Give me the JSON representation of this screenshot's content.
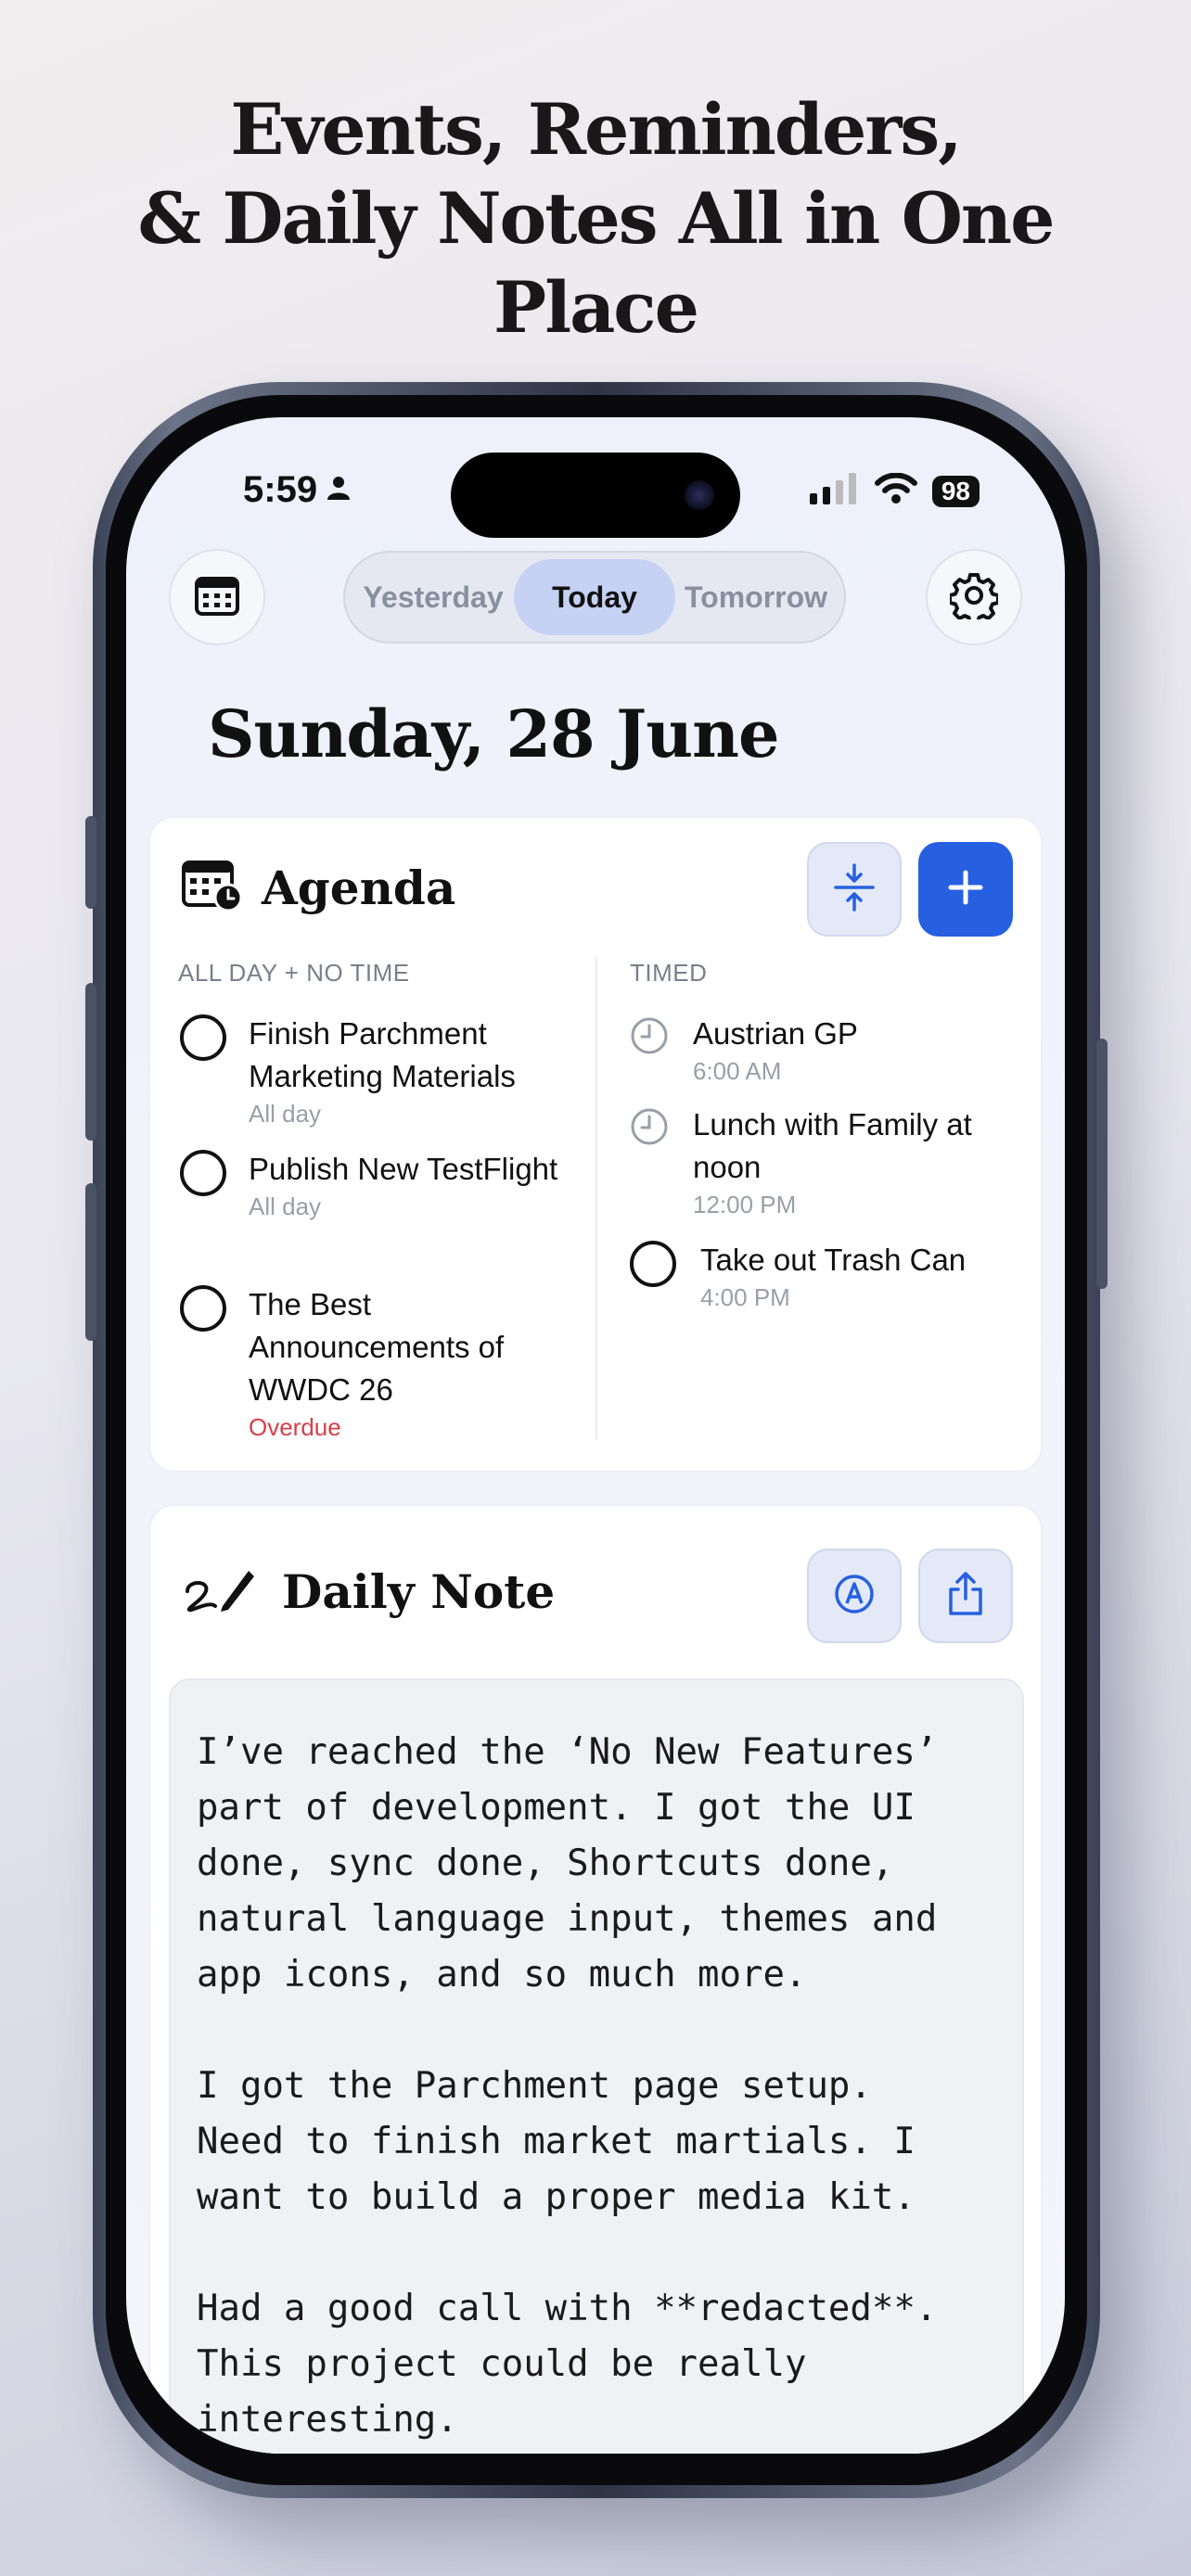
{
  "headline": {
    "line1": "Events, Reminders,",
    "line2": "& Daily Notes All in One",
    "line3": "Place"
  },
  "status_bar": {
    "time": "5:59",
    "battery": "98"
  },
  "toolbar": {
    "segments": [
      "Yesterday",
      "Today",
      "Tomorrow"
    ],
    "active_segment": "Today"
  },
  "date_title": "Sunday, 28 June",
  "agenda": {
    "title": "Agenda",
    "all_day_label": "ALL DAY + NO TIME",
    "timed_label": "TIMED",
    "all_day_items": [
      {
        "title": "Finish Parchment Marketing Materials",
        "sub": "All day"
      },
      {
        "title": "Publish New TestFlight",
        "sub": "All day"
      },
      {
        "title": "The Best Announcements of WWDC 26",
        "sub": "Overdue"
      }
    ],
    "timed_items": [
      {
        "title": "Austrian GP",
        "sub": "6:00 AM"
      },
      {
        "title": "Lunch with Family at noon",
        "sub": "12:00 PM"
      },
      {
        "title": "Take out Trash Can",
        "sub": "4:00 PM"
      }
    ]
  },
  "daily_note": {
    "title": "Daily Note",
    "text": "I’ve reached the ‘No New Features’\npart of development. I got the UI\ndone, sync done, Shortcuts done,\nnatural language input, themes and\napp icons, and so much more.\n\nI got the Parchment page setup.\nNeed to finish market martials. I\nwant to build a proper media kit.\n\nHad a good call with **redacted**.\nThis project could be really\ninteresting."
  },
  "colors": {
    "accent": "#2660e0",
    "overdue": "#d6404a",
    "segment_active": "#c5d2f3"
  },
  "icons": {
    "calendar_button": "calendar-icon",
    "settings_button": "gear-icon",
    "agenda_header": "calendar-clock-icon",
    "collapse_button": "collapse-vertical-icon",
    "add_button": "plus-icon",
    "note_header": "signature-pen-icon",
    "edit_button": "markup-pen-icon",
    "share_button": "share-icon"
  }
}
